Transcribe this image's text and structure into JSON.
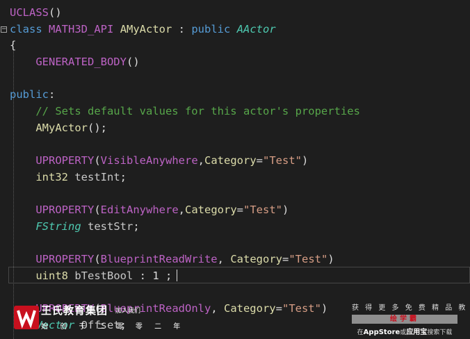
{
  "editor": {
    "lines": [
      [
        {
          "t": "UCLASS",
          "c": "macro"
        },
        {
          "t": "()",
          "c": "plain"
        }
      ],
      [
        {
          "t": "class",
          "c": "keyword"
        },
        {
          "t": " ",
          "c": "plain"
        },
        {
          "t": "MATH3D_API",
          "c": "macro"
        },
        {
          "t": " ",
          "c": "plain"
        },
        {
          "t": "AMyActor",
          "c": "func"
        },
        {
          "t": " : ",
          "c": "plain"
        },
        {
          "t": "public",
          "c": "keyword"
        },
        {
          "t": " ",
          "c": "plain"
        },
        {
          "t": "AActor",
          "c": "base"
        }
      ],
      [
        {
          "t": "{",
          "c": "plain"
        }
      ],
      [
        {
          "t": "    ",
          "c": "plain"
        },
        {
          "t": "GENERATED_BODY",
          "c": "macro"
        },
        {
          "t": "()",
          "c": "plain"
        }
      ],
      [],
      [
        {
          "t": "public",
          "c": "keyword"
        },
        {
          "t": ":",
          "c": "plain"
        }
      ],
      [
        {
          "t": "    ",
          "c": "plain"
        },
        {
          "t": "// Sets default values for this actor's properties",
          "c": "comment"
        }
      ],
      [
        {
          "t": "    ",
          "c": "plain"
        },
        {
          "t": "AMyActor",
          "c": "func"
        },
        {
          "t": "();",
          "c": "plain"
        }
      ],
      [],
      [
        {
          "t": "    ",
          "c": "plain"
        },
        {
          "t": "UPROPERTY",
          "c": "macro"
        },
        {
          "t": "(",
          "c": "plain"
        },
        {
          "t": "VisibleAnywhere",
          "c": "macro"
        },
        {
          "t": ",",
          "c": "plain"
        },
        {
          "t": "Category",
          "c": "cat"
        },
        {
          "t": "=",
          "c": "plain"
        },
        {
          "t": "\"Test\"",
          "c": "string"
        },
        {
          "t": ")",
          "c": "plain"
        }
      ],
      [
        {
          "t": "    ",
          "c": "plain"
        },
        {
          "t": "int32",
          "c": "cat"
        },
        {
          "t": " ",
          "c": "plain"
        },
        {
          "t": "testInt",
          "c": "ident"
        },
        {
          "t": ";",
          "c": "plain"
        }
      ],
      [],
      [
        {
          "t": "    ",
          "c": "plain"
        },
        {
          "t": "UPROPERTY",
          "c": "macro"
        },
        {
          "t": "(",
          "c": "plain"
        },
        {
          "t": "EditAnywhere",
          "c": "macro"
        },
        {
          "t": ",",
          "c": "plain"
        },
        {
          "t": "Category",
          "c": "cat"
        },
        {
          "t": "=",
          "c": "plain"
        },
        {
          "t": "\"Test\"",
          "c": "string"
        },
        {
          "t": ")",
          "c": "plain"
        }
      ],
      [
        {
          "t": "    ",
          "c": "plain"
        },
        {
          "t": "FString",
          "c": "struct"
        },
        {
          "t": " ",
          "c": "plain"
        },
        {
          "t": "testStr",
          "c": "ident"
        },
        {
          "t": ";",
          "c": "plain"
        }
      ],
      [],
      [
        {
          "t": "    ",
          "c": "plain"
        },
        {
          "t": "UPROPERTY",
          "c": "macro"
        },
        {
          "t": "(",
          "c": "plain"
        },
        {
          "t": "BlueprintReadWrite",
          "c": "macro"
        },
        {
          "t": ", ",
          "c": "plain"
        },
        {
          "t": "Category",
          "c": "cat"
        },
        {
          "t": "=",
          "c": "plain"
        },
        {
          "t": "\"Test\"",
          "c": "string"
        },
        {
          "t": ")",
          "c": "plain"
        }
      ],
      [
        {
          "t": "    ",
          "c": "plain"
        },
        {
          "t": "uint8",
          "c": "cat"
        },
        {
          "t": " ",
          "c": "plain"
        },
        {
          "t": "bTestBool",
          "c": "ident"
        },
        {
          "t": " : 1 ;",
          "c": "plain"
        }
      ],
      [],
      [
        {
          "t": "    ",
          "c": "plain"
        },
        {
          "t": "UPROPERTY",
          "c": "macro"
        },
        {
          "t": "(",
          "c": "plain"
        },
        {
          "t": "BlueprintReadOnly",
          "c": "macro"
        },
        {
          "t": ", ",
          "c": "plain"
        },
        {
          "t": "Category",
          "c": "cat"
        },
        {
          "t": "=",
          "c": "plain"
        },
        {
          "t": "\"Test\"",
          "c": "string"
        },
        {
          "t": ")",
          "c": "plain"
        }
      ],
      [
        {
          "t": "    ",
          "c": "plain"
        },
        {
          "t": "Vector",
          "c": "struct"
        },
        {
          "t": " ",
          "c": "plain"
        },
        {
          "t": "Offset",
          "c": "ident"
        },
        {
          "t": ";",
          "c": "plain"
        }
      ]
    ],
    "fold_symbol": "−"
  },
  "watermark": {
    "org": "王氏教育集团",
    "org_sub": "加入我们",
    "slogan": "始 创 于 二 零 零 二 年",
    "right_line1": "获 得 更 多 免 费 精 品 教 程",
    "right_bar": "绘学霸",
    "right_line2_pre": "在",
    "right_line2_bold": "AppStore",
    "right_line2_mid": "或",
    "right_line2_bold2": "应用宝",
    "right_line2_post": "搜索下载"
  },
  "colors": {
    "background": "#1e1e1e",
    "macro": "#bd63c5",
    "keyword": "#569cd6",
    "function": "#dcdcaa",
    "comment": "#57a64a",
    "string": "#d69d85",
    "brand_red": "#c8101e"
  }
}
